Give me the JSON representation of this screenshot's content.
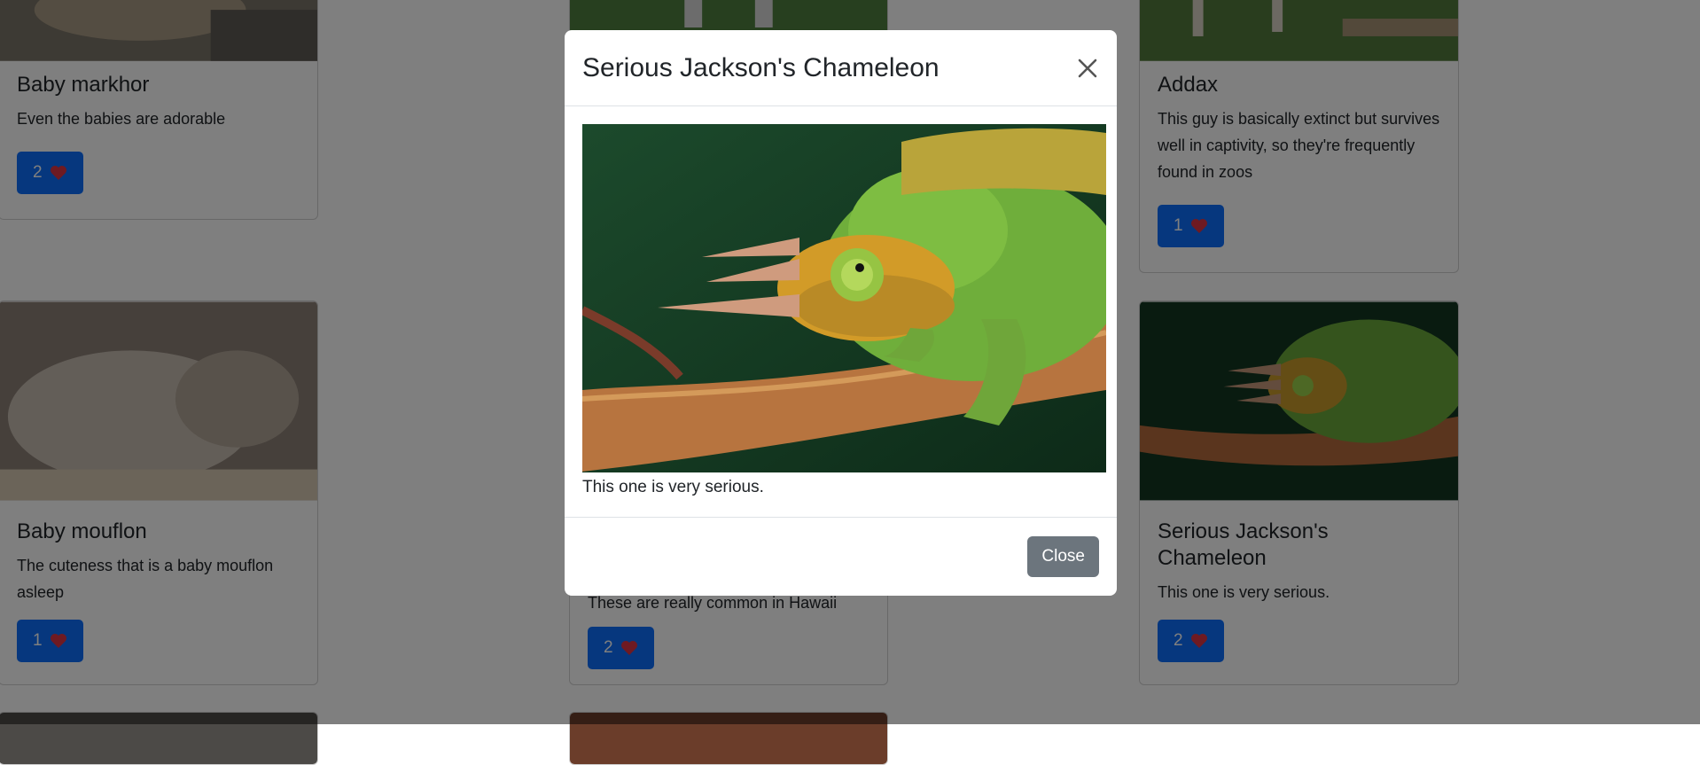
{
  "cards": [
    {
      "title": "Baby markhor",
      "text": "Even the babies are adorable",
      "likes": "2"
    },
    {
      "title": "Addax",
      "text": "This guy is basically extinct but survives well in captivity, so they're frequently found in zoos",
      "likes": "1"
    },
    {
      "title": "Baby mouflon",
      "text": "The cuteness that is a baby mouflon asleep",
      "likes": "1"
    },
    {
      "title": "",
      "text": "These are really common in Hawaii",
      "likes": "2"
    },
    {
      "title": "Serious Jackson's Chameleon",
      "text": "This one is very serious.",
      "likes": "2"
    }
  ],
  "modal": {
    "title": "Serious Jackson's Chameleon",
    "description": "This one is very serious.",
    "close_label": "Close"
  },
  "colors": {
    "primary": "#0d6efd",
    "secondary": "#6c757d",
    "heart": "#dc3545",
    "backdrop": "rgba(0,0,0,0.5)"
  },
  "icons": {
    "like": "heart-icon",
    "dismiss": "close-icon"
  }
}
